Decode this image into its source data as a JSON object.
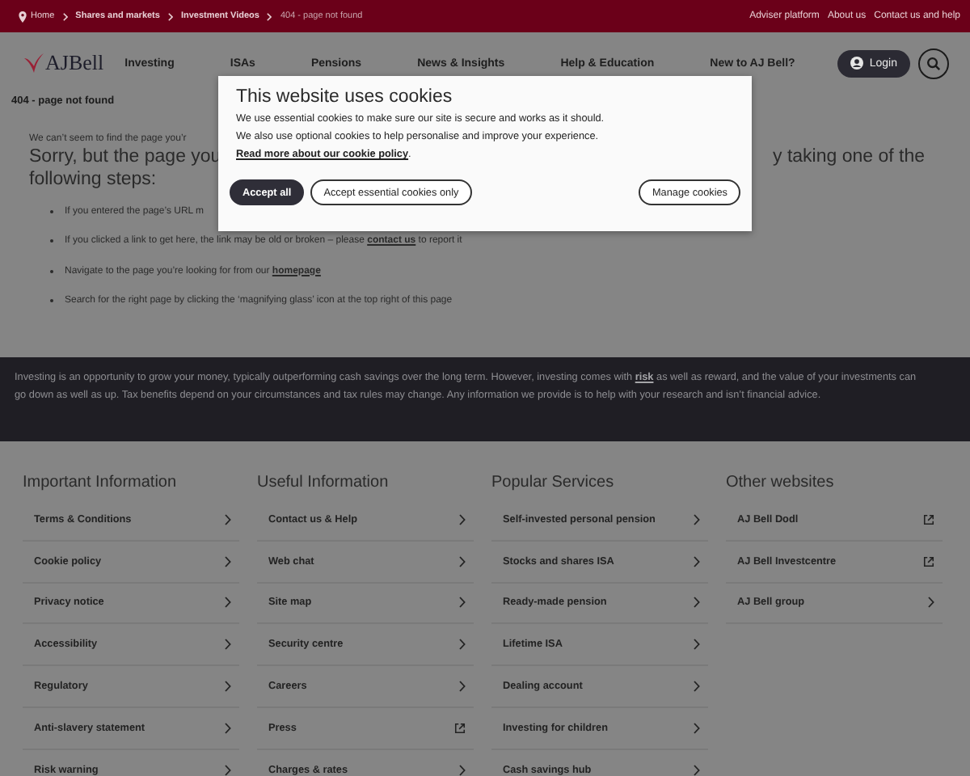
{
  "breadcrumb": [
    {
      "label": "Home",
      "kind": "home"
    },
    {
      "label": "Shares and markets",
      "kind": "link"
    },
    {
      "label": "Investment Videos",
      "kind": "link"
    },
    {
      "label": "404 - page not found",
      "kind": "current"
    }
  ],
  "top_links": [
    "Adviser platform",
    "About us",
    "Contact us and help"
  ],
  "header": {
    "logo": "AJBell",
    "nav": [
      "Investing",
      "ISAs",
      "Pensions",
      "News & Insights",
      "Help & Education",
      "New to AJ Bell?"
    ],
    "login": "Login"
  },
  "page": {
    "title": "404 - page not found",
    "intro": "We can’t seem to find the page you’r",
    "heading_left": "Sorry, but the page you",
    "heading_right": "y taking one of the",
    "heading_line2": "following steps:",
    "steps": [
      {
        "text": "If you entered the page’s URL m"
      },
      {
        "text": "If you clicked a link to get here, the link may be old or broken – please ",
        "link": "contact us",
        "after": " to report it"
      },
      {
        "text": "Navigate to the page you’re looking for from our ",
        "link": "homepage"
      },
      {
        "text": "Search for the right page by clicking the ‘magnifying glass’ icon at the top right of this page"
      }
    ]
  },
  "disclaimer": {
    "before": "Investing is an opportunity to grow your money, typically outperforming cash savings over the long term. However, investing comes with ",
    "link": "risk",
    "after": " as well as reward, and the value of your investments can go down as well as up. Tax benefits depend on your circumstances and tax rules may change. Any information we provide is to help with your research and isn’t financial advice."
  },
  "footer": [
    {
      "heading": "Important Information",
      "links": [
        {
          "label": "Terms & Conditions",
          "kind": "internal"
        },
        {
          "label": "Cookie policy",
          "kind": "internal"
        },
        {
          "label": "Privacy notice",
          "kind": "internal"
        },
        {
          "label": "Accessibility",
          "kind": "internal"
        },
        {
          "label": "Regulatory",
          "kind": "internal"
        },
        {
          "label": "Anti-slavery statement",
          "kind": "internal"
        },
        {
          "label": "Risk warning",
          "kind": "internal"
        }
      ]
    },
    {
      "heading": "Useful Information",
      "links": [
        {
          "label": "Contact us & Help",
          "kind": "internal"
        },
        {
          "label": "Web chat",
          "kind": "internal"
        },
        {
          "label": "Site map",
          "kind": "internal"
        },
        {
          "label": "Security centre",
          "kind": "internal"
        },
        {
          "label": "Careers",
          "kind": "internal"
        },
        {
          "label": "Press",
          "kind": "external"
        },
        {
          "label": "Charges & rates",
          "kind": "internal"
        }
      ]
    },
    {
      "heading": "Popular Services",
      "links": [
        {
          "label": "Self-invested personal pension",
          "kind": "internal"
        },
        {
          "label": "Stocks and shares ISA",
          "kind": "internal"
        },
        {
          "label": "Ready-made pension",
          "kind": "internal"
        },
        {
          "label": "Lifetime ISA",
          "kind": "internal"
        },
        {
          "label": "Dealing account",
          "kind": "internal"
        },
        {
          "label": "Investing for children",
          "kind": "internal"
        },
        {
          "label": "Cash savings hub",
          "kind": "internal"
        }
      ]
    },
    {
      "heading": "Other websites",
      "links": [
        {
          "label": "AJ Bell Dodl",
          "kind": "external"
        },
        {
          "label": "AJ Bell Investcentre",
          "kind": "external"
        },
        {
          "label": "AJ Bell group",
          "kind": "internal"
        }
      ]
    }
  ],
  "cookie_banner": {
    "title": "This website uses cookies",
    "lines": [
      "We use essential cookies to make sure our site is secure and works as it should.",
      "We also use optional cookies to help personalise and improve your experience."
    ],
    "link": "Read more about our cookie policy",
    "after": ".",
    "buttons": [
      {
        "label": "Accept all",
        "kind": "primary"
      },
      {
        "label": "Accept essential cookies only",
        "kind": "outline"
      },
      {
        "label": "Manage cookies",
        "kind": "outline-right"
      }
    ]
  }
}
